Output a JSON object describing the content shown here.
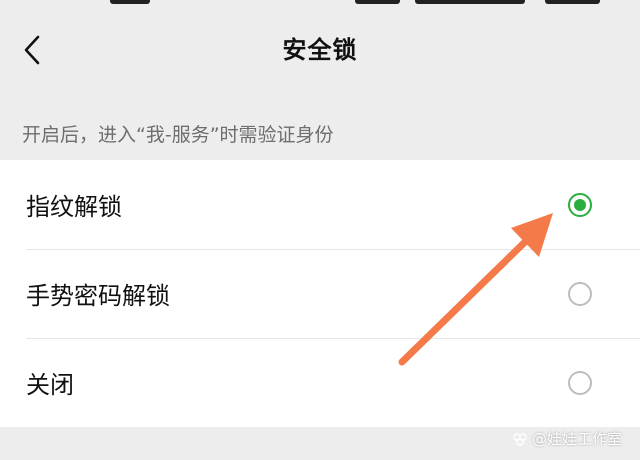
{
  "header": {
    "title": "安全锁",
    "back_icon": "chevron-left-icon"
  },
  "hint": "开启后，进入“我-服务”时需验证身份",
  "options": [
    {
      "label": "指纹解锁",
      "selected": true
    },
    {
      "label": "手势密码解锁",
      "selected": false
    },
    {
      "label": "关闭",
      "selected": false
    }
  ],
  "colors": {
    "accent": "#2aae3f",
    "annotation_arrow": "#f47a4a",
    "background": "#ededed"
  },
  "watermark": "@娃娃工作室"
}
